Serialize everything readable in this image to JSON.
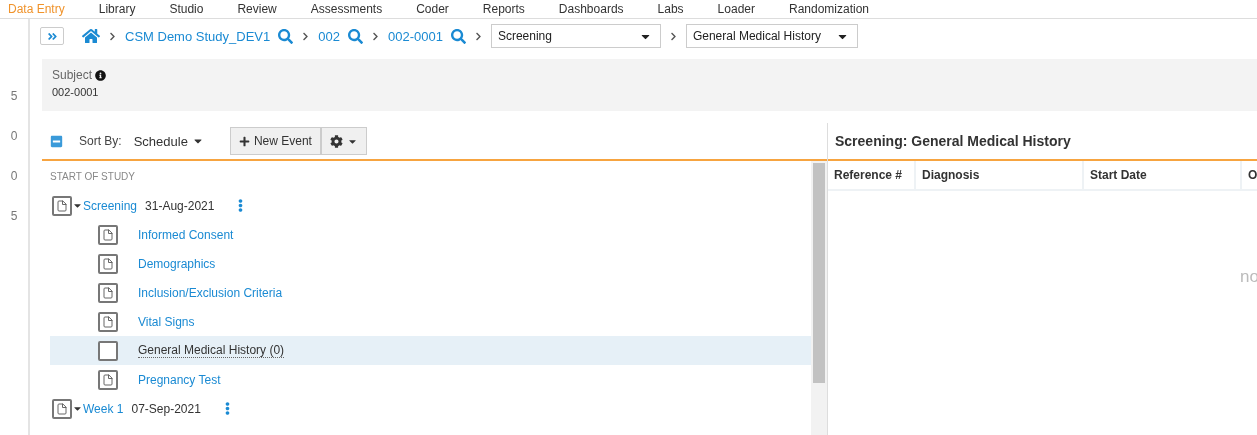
{
  "nav": [
    {
      "label": "Data Entry",
      "selected": true
    },
    {
      "label": "Library",
      "selected": false
    },
    {
      "label": "Studio",
      "selected": false
    },
    {
      "label": "Review",
      "selected": false
    },
    {
      "label": "Assessments",
      "selected": false
    },
    {
      "label": "Coder",
      "selected": false
    },
    {
      "label": "Reports",
      "selected": false
    },
    {
      "label": "Dashboards",
      "selected": false
    },
    {
      "label": "Labs",
      "selected": false
    },
    {
      "label": "Loader",
      "selected": false
    },
    {
      "label": "Randomization",
      "selected": false
    }
  ],
  "gutter_marks": [
    "5",
    "0",
    "0",
    "5"
  ],
  "breadcrumb": {
    "links": [
      "CSM Demo Study_DEV1",
      "002",
      "002-0001"
    ],
    "event_select": "Screening",
    "form_select": "General Medical History"
  },
  "subject": {
    "label": "Subject",
    "value": "002-0001"
  },
  "toolbar": {
    "sort_label": "Sort By:",
    "sort_value": "Schedule",
    "new_event": "New Event"
  },
  "tree": {
    "start_label": "START OF STUDY",
    "events": [
      {
        "name": "Screening",
        "date": "31-Aug-2021",
        "expanded": true,
        "forms": [
          {
            "name": "Informed Consent",
            "kind": "document",
            "selected": false
          },
          {
            "name": "Demographics",
            "kind": "document",
            "selected": false
          },
          {
            "name": "Inclusion/Exclusion Criteria",
            "kind": "document",
            "selected": false
          },
          {
            "name": "Vital Signs",
            "kind": "document",
            "selected": false
          },
          {
            "name": "General Medical History (0)",
            "kind": "blank",
            "selected": true
          },
          {
            "name": "Pregnancy Test",
            "kind": "document",
            "selected": false
          }
        ]
      },
      {
        "name": "Week 1",
        "date": "07-Sep-2021",
        "expanded": true
      }
    ]
  },
  "detail": {
    "title": "Screening: General Medical History",
    "columns": [
      "Reference #",
      "Diagnosis",
      "Start Date",
      "O"
    ],
    "empty_text": "no"
  }
}
